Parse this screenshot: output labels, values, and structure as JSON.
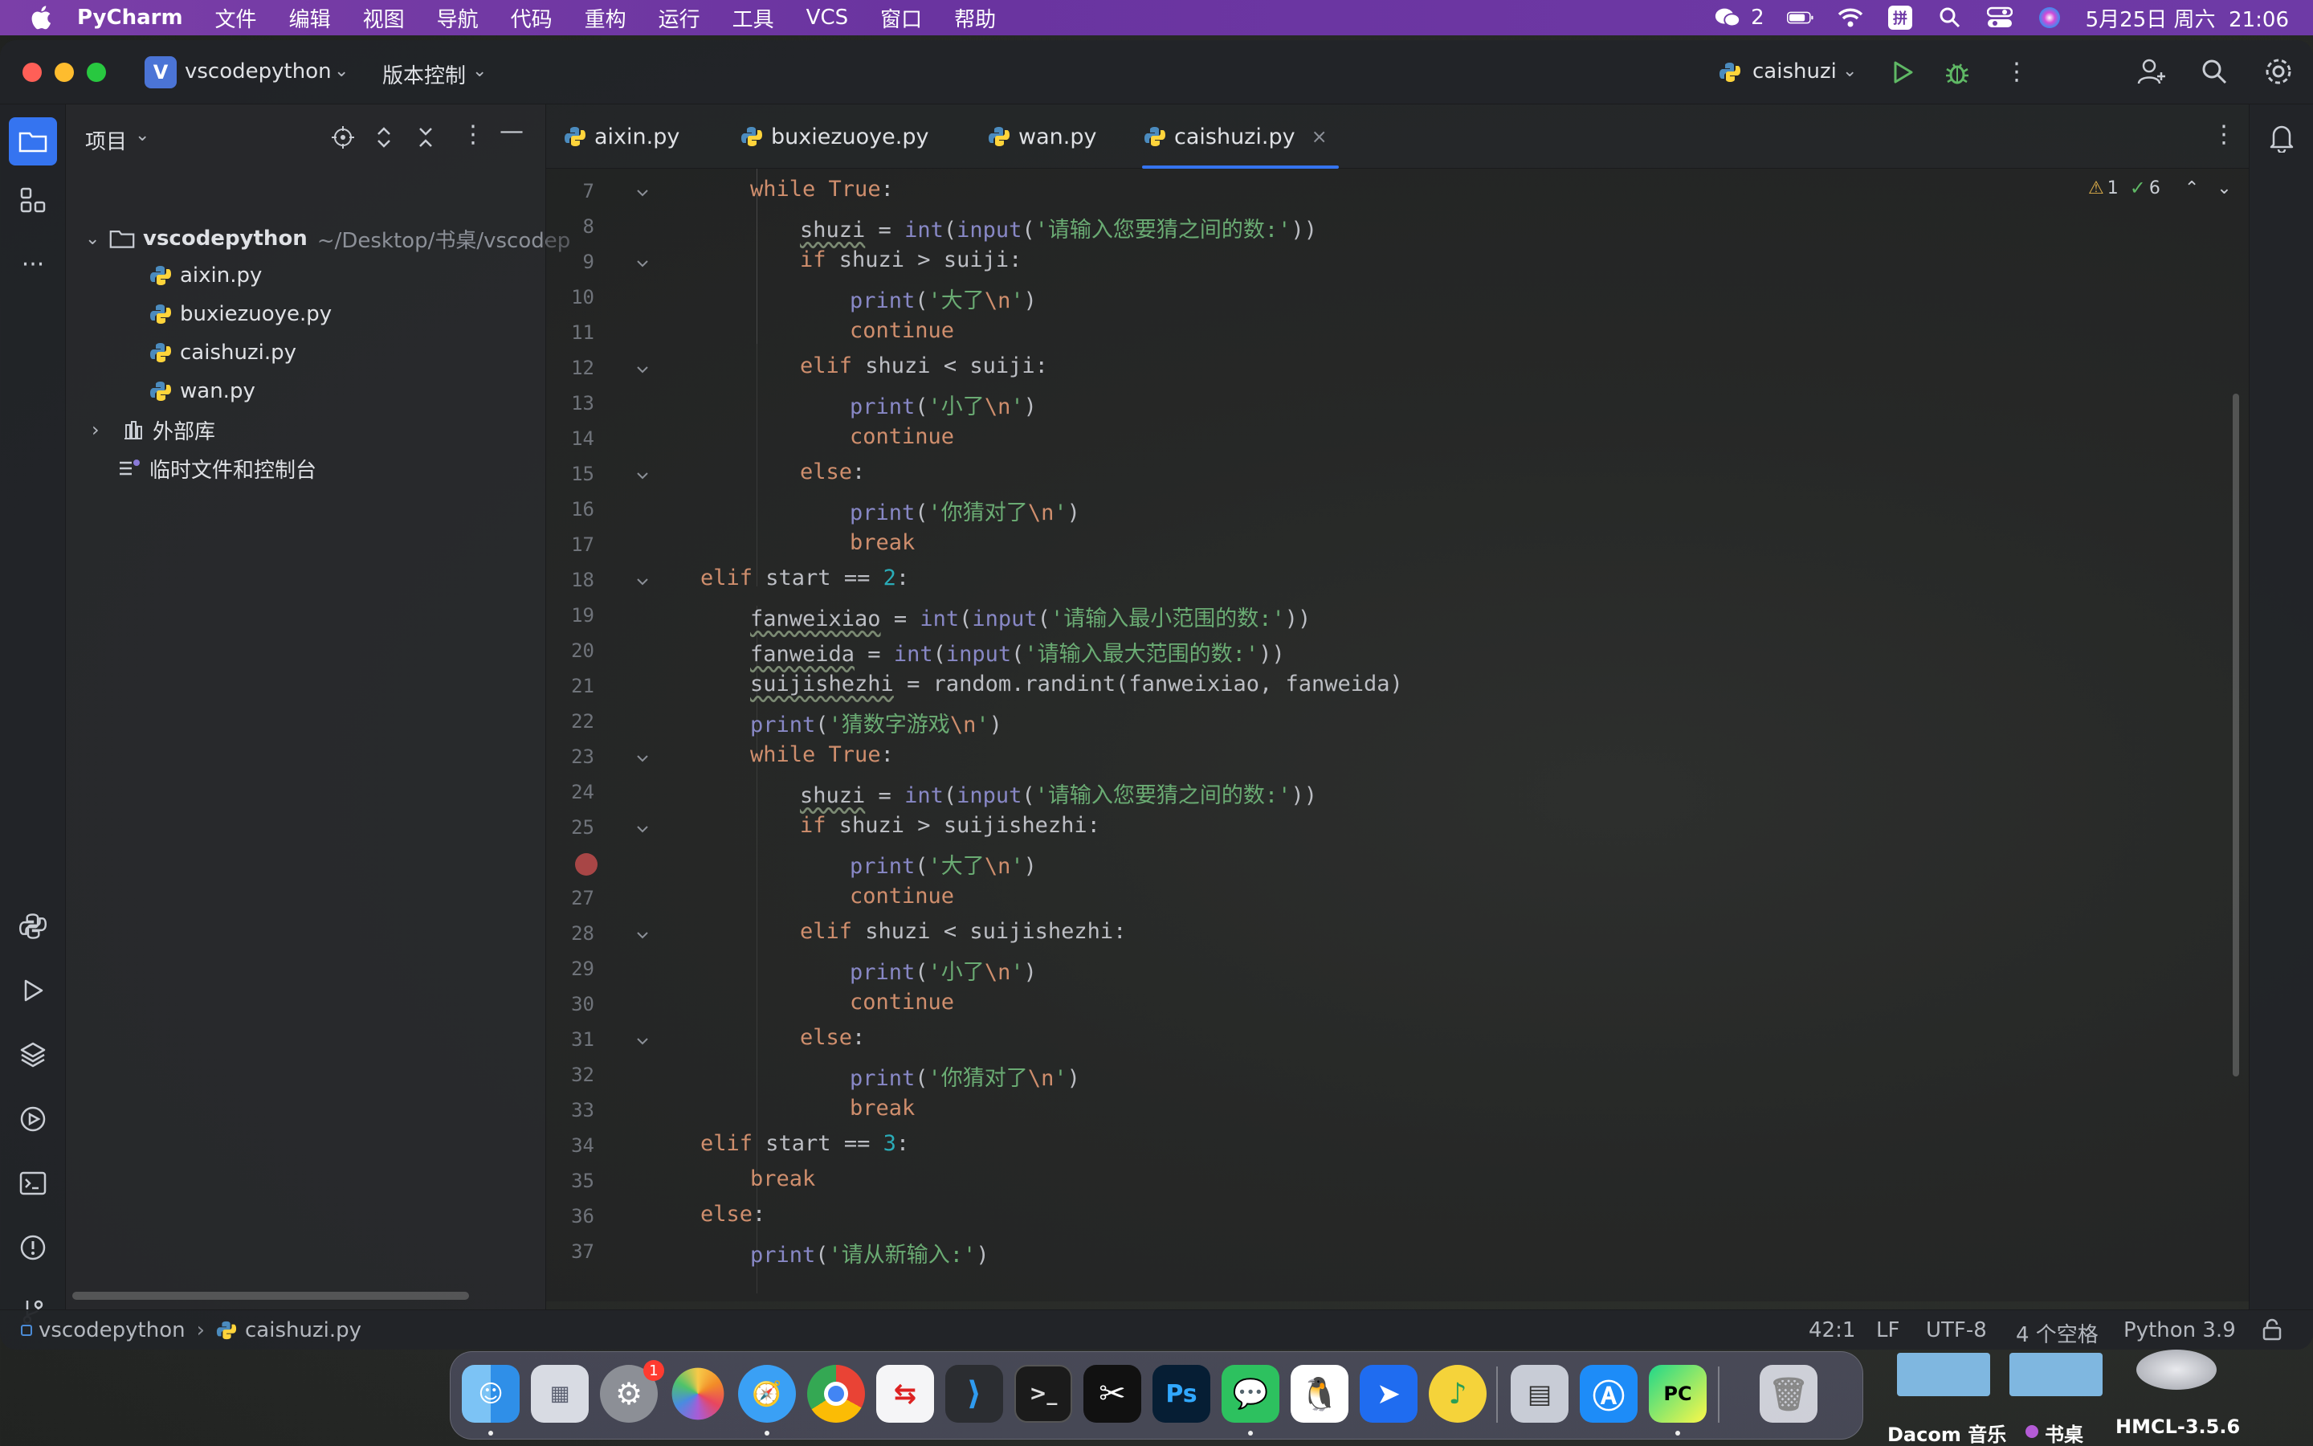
{
  "menubar": {
    "app": "PyCharm",
    "items": [
      "文件",
      "编辑",
      "视图",
      "导航",
      "代码",
      "重构",
      "运行",
      "工具",
      "VCS",
      "窗口",
      "帮助"
    ],
    "wechat_count": "2",
    "datetime": "5月25日 周六  21:06"
  },
  "titlebar": {
    "project_badge": "V",
    "project_name": "vscodepython",
    "vcs_label": "版本控制",
    "run_config": "caishuzi"
  },
  "project_panel": {
    "title": "项目",
    "root_name": "vscodepython",
    "root_path": "~/Desktop/书桌/vscodep",
    "files": [
      "aixin.py",
      "buxiezuoye.py",
      "caishuzi.py",
      "wan.py"
    ],
    "external_libs": "外部库",
    "scratches": "临时文件和控制台"
  },
  "tabs": [
    {
      "label": "aixin.py"
    },
    {
      "label": "buxiezuoye.py"
    },
    {
      "label": "wan.py"
    },
    {
      "label": "caishuzi.py",
      "active": true
    }
  ],
  "inspections": {
    "warnings": "1",
    "ok": "6"
  },
  "code": {
    "line_numbers": [
      "7",
      "8",
      "9",
      "10",
      "11",
      "12",
      "13",
      "14",
      "15",
      "16",
      "17",
      "18",
      "19",
      "20",
      "21",
      "22",
      "23",
      "24",
      "25",
      "",
      "27",
      "28",
      "29",
      "30",
      "31",
      "32",
      "33",
      "34",
      "35",
      "36",
      "37"
    ],
    "lines": [
      "while True:",
      "shuzi = int(input('请输入您要猜之间的数:'))",
      "if shuzi > suiji:",
      "print('大了\\n')",
      "continue",
      "elif shuzi < suiji:",
      "print('小了\\n')",
      "continue",
      "else:",
      "print('你猜对了\\n')",
      "break",
      "elif start == 2:",
      "fanweixiao = int(input('请输入最小范围的数:'))",
      "fanweida = int(input('请输入最大范围的数:'))",
      "suijishezhi = random.randint(fanweixiao, fanweida)",
      "print('猜数字游戏\\n')",
      "while True:",
      "shuzi = int(input('请输入您要猜之间的数:'))",
      "if shuzi > suijishezhi:",
      "print('大了\\n')",
      "continue",
      "elif shuzi < suijishezhi:",
      "print('小了\\n')",
      "continue",
      "else:",
      "print('你猜对了\\n')",
      "break",
      "elif start == 3:",
      "break",
      "else:",
      "print('请从新输入:')"
    ]
  },
  "statusbar": {
    "breadcrumb_project": "vscodepython",
    "breadcrumb_file": "caishuzi.py",
    "position": "42:1",
    "line_sep": "LF",
    "encoding": "UTF-8",
    "indent": "4 个空格",
    "interpreter": "Python 3.9"
  },
  "dock": {
    "settings_badge": "1",
    "ps_label": "Ps",
    "pc_label": "PC",
    "desktop_labels": [
      "Dacom 音乐",
      "书桌",
      "HMCL-3.5.6"
    ]
  }
}
